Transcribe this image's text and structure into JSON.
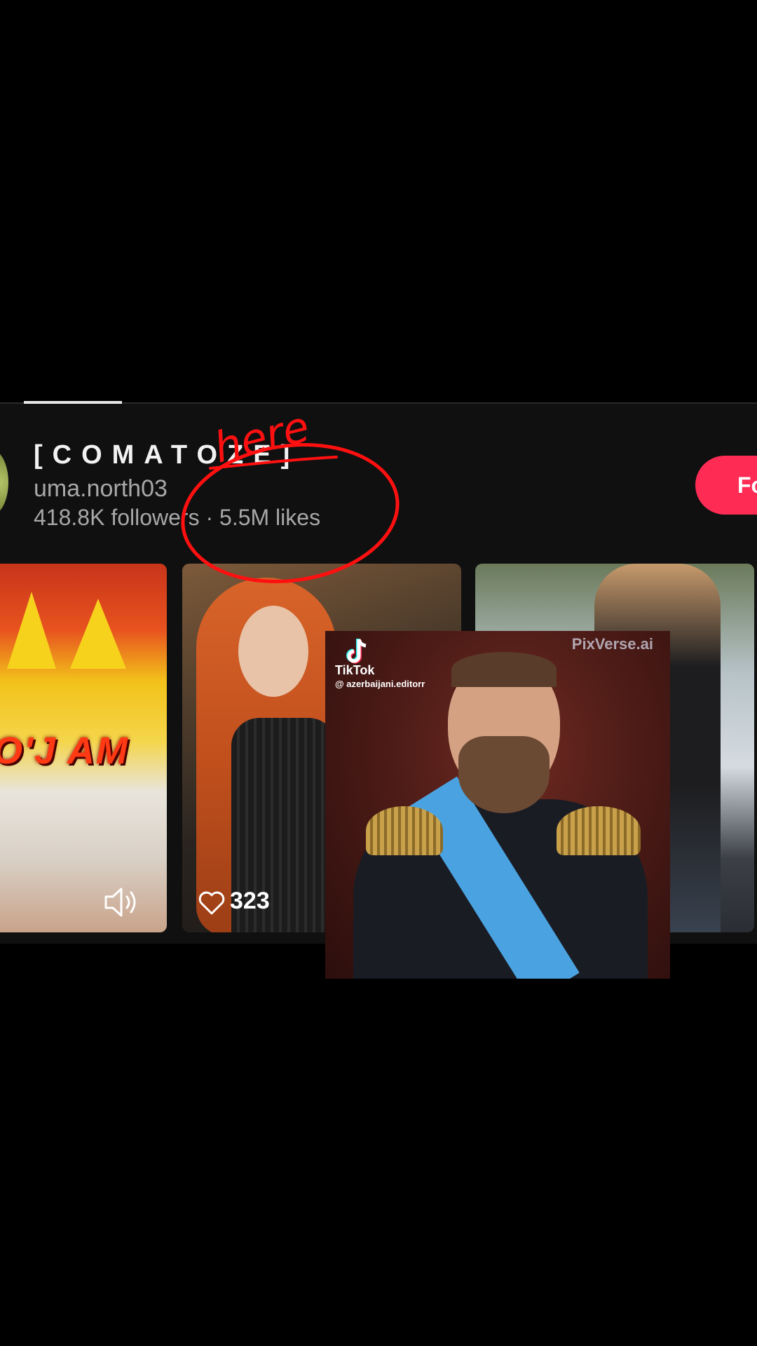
{
  "profile": {
    "display_name": "[COMATOZE]",
    "username": "uma.north03",
    "stats": "418.8K followers · 5.5M likes",
    "follow_label": "Fo"
  },
  "annotation": {
    "text": "here",
    "color": "#ff1010"
  },
  "videos": [
    {
      "caption": "O'J AM",
      "icon": "speaker-icon"
    },
    {
      "likes": "323",
      "icon": "heart-icon"
    },
    {}
  ],
  "overlay": {
    "watermark_app": "TikTok",
    "watermark_handle": "@ azerbaijani.editorr",
    "ai_watermark": "PixVerse.ai"
  },
  "colors": {
    "accent": "#fe2c55",
    "background": "#000000",
    "card": "#101010"
  }
}
